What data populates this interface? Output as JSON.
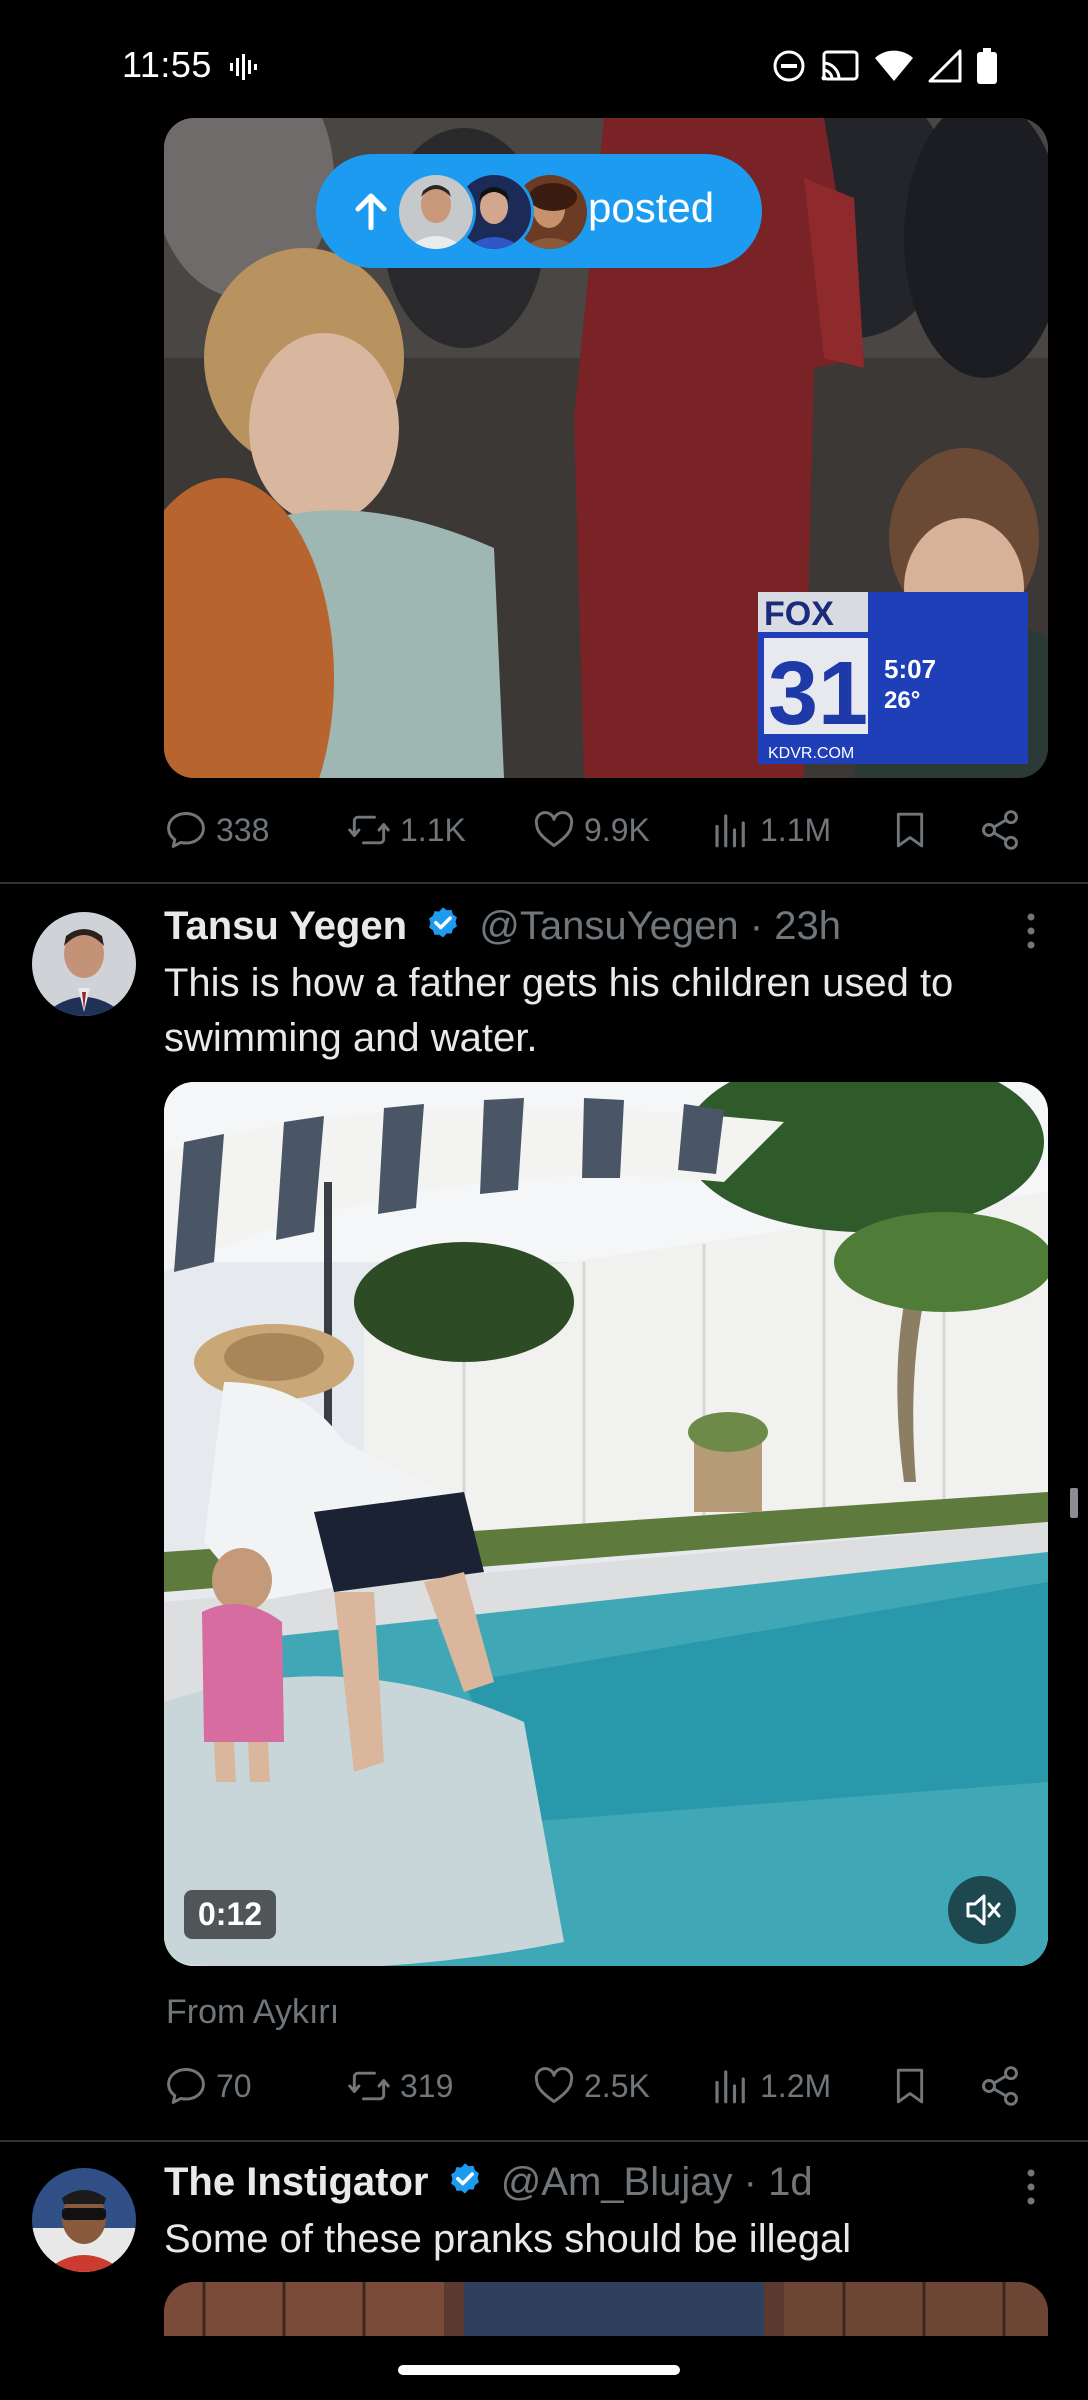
{
  "status_bar": {
    "time": "11:55",
    "icons": [
      "audio-waveform-icon",
      "do-not-disturb-icon",
      "cast-icon",
      "wifi-icon",
      "signal-icon",
      "battery-icon"
    ]
  },
  "posted_pill": {
    "label": "posted",
    "icon": "arrow-up-icon"
  },
  "posts": [
    {
      "id": "post-1",
      "media": "Image: courtroom crowd with FOX 31 KDVR news overlay",
      "stats": {
        "replies": "338",
        "reposts": "1.1K",
        "likes": "9.9K",
        "views": "1.1M"
      }
    },
    {
      "id": "post-2",
      "author": "Tansu Yegen",
      "handle": "@TansuYegen",
      "time": "23h",
      "separator": "·",
      "text": "This is how a father gets his children used to swimming and water.",
      "video": {
        "duration": "0:12",
        "muted": true
      },
      "source": "From Aykırı",
      "stats": {
        "replies": "70",
        "reposts": "319",
        "likes": "2.5K",
        "views": "1.2M"
      }
    },
    {
      "id": "post-3",
      "author": "The Instigator",
      "handle": "@Am_Blujay",
      "time": "1d",
      "separator": "·",
      "text": "Some of these pranks should be illegal"
    }
  ],
  "colors": {
    "accent": "#1d9bf0",
    "muted": "#71767b",
    "background": "#000000",
    "divider": "#2f3336"
  }
}
